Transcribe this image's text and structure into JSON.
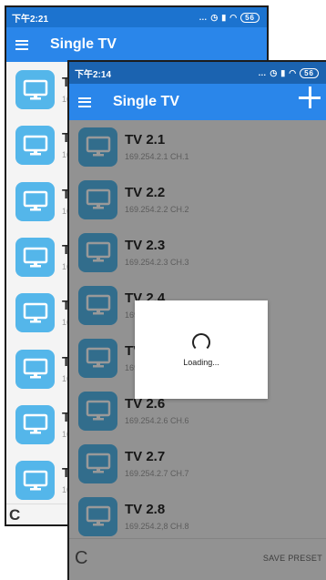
{
  "back_screen": {
    "status_time": "下午2:21",
    "battery": "56",
    "app_title": "Single TV",
    "items": [
      {
        "name": "T",
        "sub": "16"
      },
      {
        "name": "T",
        "sub": "16"
      },
      {
        "name": "T",
        "sub": "16"
      },
      {
        "name": "T",
        "sub": "16"
      },
      {
        "name": "T",
        "sub": "16"
      },
      {
        "name": "T",
        "sub": "16"
      },
      {
        "name": "T",
        "sub": "16"
      },
      {
        "name": "T",
        "sub": "16"
      }
    ],
    "refresh_glyph": "C"
  },
  "front_screen": {
    "status_time": "下午2:14",
    "battery": "56",
    "app_title": "Single TV",
    "items": [
      {
        "name": "TV 2.1",
        "sub": "169.254.2.1  CH.1"
      },
      {
        "name": "TV 2.2",
        "sub": "169.254.2.2  CH.2"
      },
      {
        "name": "TV 2.3",
        "sub": "169.254.2.3  CH.3"
      },
      {
        "name": "TV 2.4",
        "sub": "169.254.2.4  CH.4"
      },
      {
        "name": "TV 2.5",
        "sub": "169.254.2.5  CH.5"
      },
      {
        "name": "TV 2.6",
        "sub": "169.254.2.6  CH.6"
      },
      {
        "name": "TV 2.7",
        "sub": "169.254.2.7  CH.7"
      },
      {
        "name": "TV 2.8",
        "sub": "169.254.2,8  CH.8"
      }
    ],
    "refresh_glyph": "C",
    "save_preset": "SAVE PRESET",
    "loading_text": "Loading..."
  },
  "colors": {
    "statusbar": "#1c73cf",
    "appbar": "#2a86ea",
    "tv_tile": "#54b6ea"
  },
  "icons": {
    "menu": "hamburger-menu-icon",
    "add": "plus-icon",
    "tv": "tv-monitor-icon",
    "refresh": "refresh-icon",
    "spinner": "loading-spinner-icon"
  }
}
